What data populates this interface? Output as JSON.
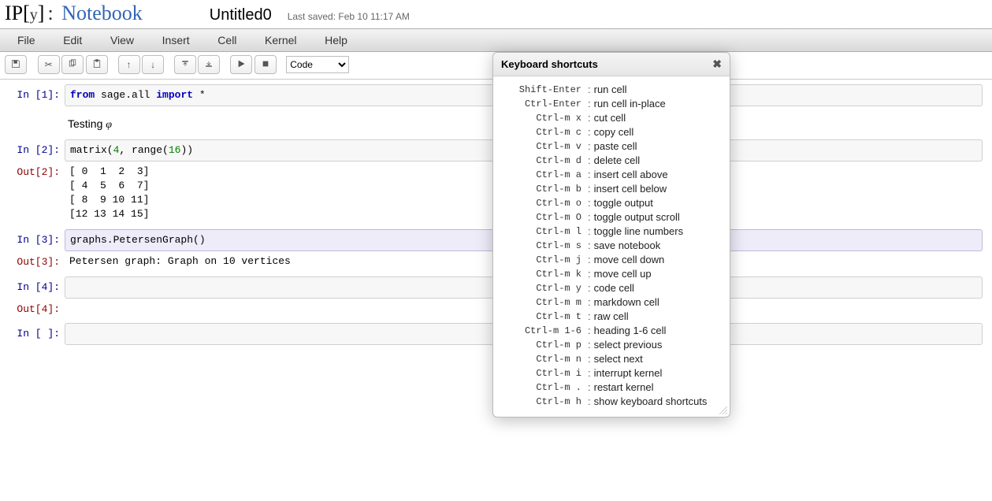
{
  "logo": {
    "ip": "IP",
    "open": "[",
    "y": "y",
    "close": "]",
    "colon": ":",
    "notebook": "Notebook"
  },
  "notebook_name": "Untitled0",
  "last_saved": "Last saved: Feb 10 11:17 AM",
  "menus": [
    "File",
    "Edit",
    "View",
    "Insert",
    "Cell",
    "Kernel",
    "Help"
  ],
  "cell_type_option": "Code",
  "cells": {
    "c1": {
      "in_prompt": "In [1]:",
      "code_html": "<span class='s-from'>from</span> sage.all <span class='s-from'>import</span> *"
    },
    "md1": {
      "text_html": "Testing <span class='phi-it'>φ</span>"
    },
    "c2": {
      "in_prompt": "In [2]:",
      "code_html": "matrix(<span class='k-num'>4</span>, range(<span class='k-num'>16</span>))",
      "out_prompt": "Out[2]:",
      "out_text": "[ 0  1  2  3]\n[ 4  5  6  7]\n[ 8  9 10 11]\n[12 13 14 15]"
    },
    "c3": {
      "in_prompt": "In [3]:",
      "code_html": "graphs.PetersenGraph()",
      "selected": true,
      "out_prompt": "Out[3]:",
      "out_text": "Petersen graph: Graph on 10 vertices"
    },
    "c4": {
      "in_prompt": "In [4]:",
      "code_html": "",
      "out_prompt": "Out[4]:",
      "out_text": ""
    },
    "c5": {
      "in_prompt": "In [ ]:",
      "code_html": ""
    }
  },
  "dialog": {
    "title": "Keyboard shortcuts",
    "items": [
      {
        "k": "Shift-Enter",
        "d": "run cell"
      },
      {
        "k": "Ctrl-Enter",
        "d": "run cell in-place"
      },
      {
        "k": "Ctrl-m x",
        "d": "cut cell"
      },
      {
        "k": "Ctrl-m c",
        "d": "copy cell"
      },
      {
        "k": "Ctrl-m v",
        "d": "paste cell"
      },
      {
        "k": "Ctrl-m d",
        "d": "delete cell"
      },
      {
        "k": "Ctrl-m a",
        "d": "insert cell above"
      },
      {
        "k": "Ctrl-m b",
        "d": "insert cell below"
      },
      {
        "k": "Ctrl-m o",
        "d": "toggle output"
      },
      {
        "k": "Ctrl-m O",
        "d": "toggle output scroll"
      },
      {
        "k": "Ctrl-m l",
        "d": "toggle line numbers"
      },
      {
        "k": "Ctrl-m s",
        "d": "save notebook"
      },
      {
        "k": "Ctrl-m j",
        "d": "move cell down"
      },
      {
        "k": "Ctrl-m k",
        "d": "move cell up"
      },
      {
        "k": "Ctrl-m y",
        "d": "code cell"
      },
      {
        "k": "Ctrl-m m",
        "d": "markdown cell"
      },
      {
        "k": "Ctrl-m t",
        "d": "raw cell"
      },
      {
        "k": "Ctrl-m 1-6",
        "d": "heading 1-6 cell"
      },
      {
        "k": "Ctrl-m p",
        "d": "select previous"
      },
      {
        "k": "Ctrl-m n",
        "d": "select next"
      },
      {
        "k": "Ctrl-m i",
        "d": "interrupt kernel"
      },
      {
        "k": "Ctrl-m .",
        "d": "restart kernel"
      },
      {
        "k": "Ctrl-m h",
        "d": "show keyboard shortcuts"
      }
    ]
  }
}
